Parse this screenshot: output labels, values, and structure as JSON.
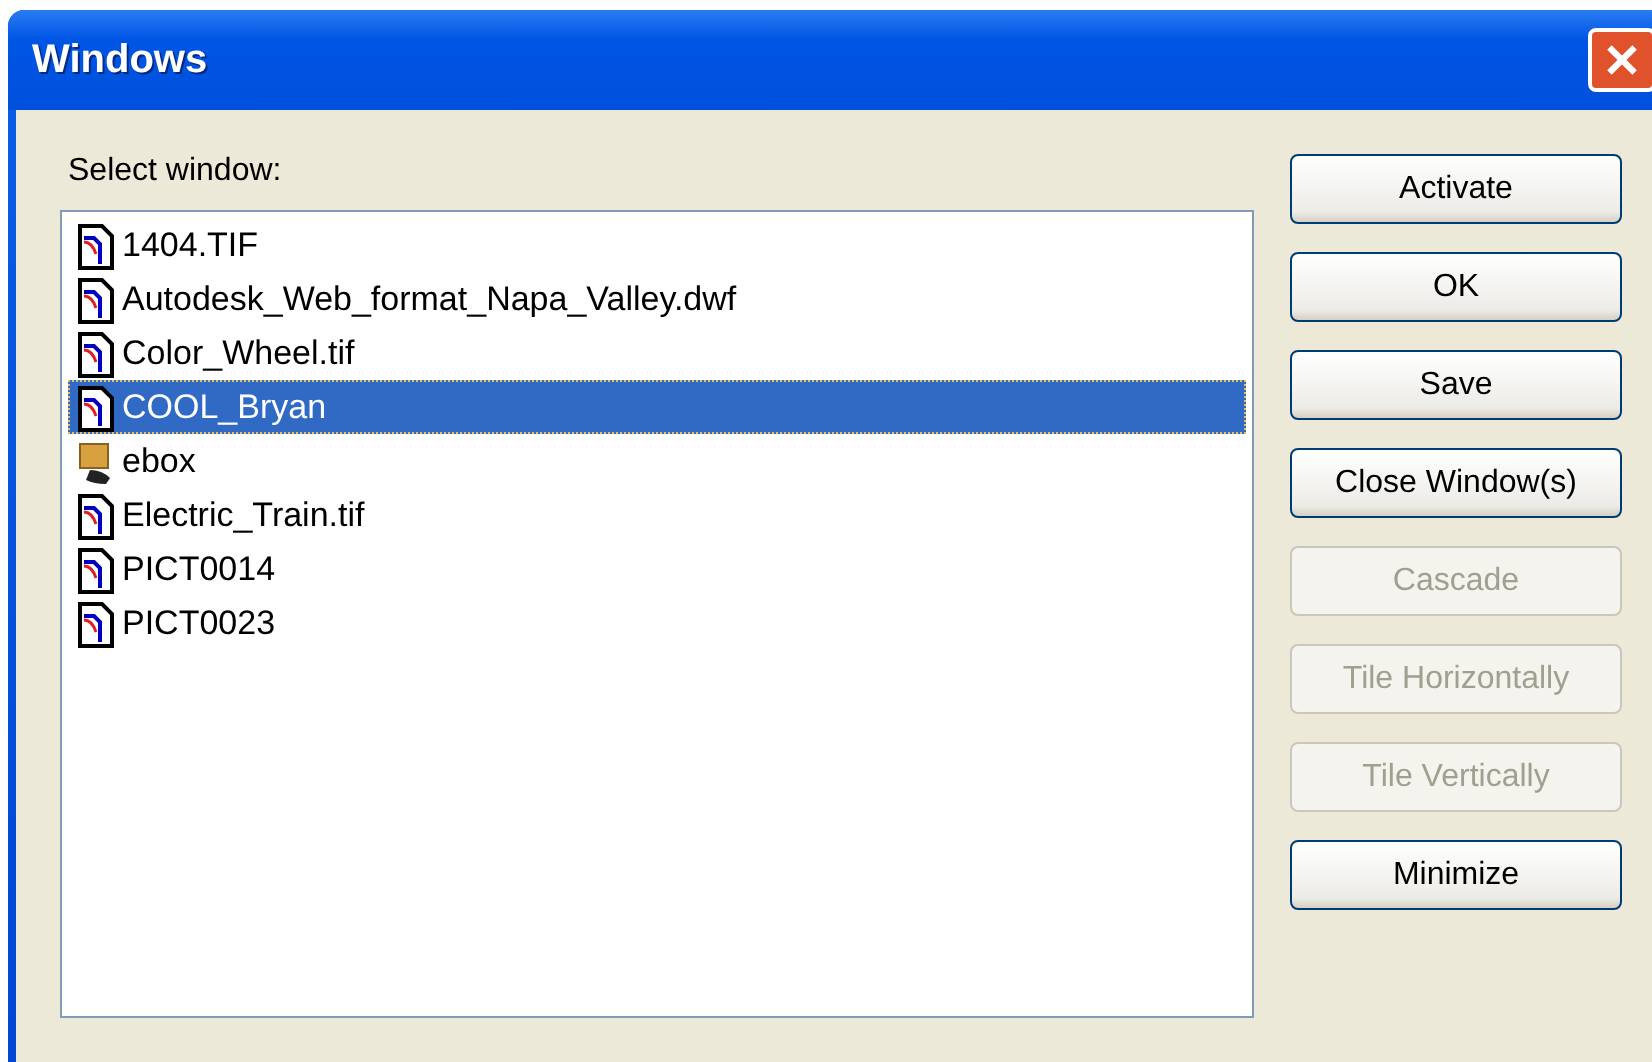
{
  "window": {
    "title": "Windows"
  },
  "list": {
    "label": "Select window:",
    "items": [
      {
        "name": "1404.TIF",
        "kind": "document",
        "selected": false
      },
      {
        "name": "Autodesk_Web_format_Napa_Valley.dwf",
        "kind": "document",
        "selected": false
      },
      {
        "name": "Color_Wheel.tif",
        "kind": "document",
        "selected": false
      },
      {
        "name": "COOL_Bryan",
        "kind": "document",
        "selected": true
      },
      {
        "name": "ebox",
        "kind": "box",
        "selected": false
      },
      {
        "name": "Electric_Train.tif",
        "kind": "document",
        "selected": false
      },
      {
        "name": "PICT0014",
        "kind": "document",
        "selected": false
      },
      {
        "name": "PICT0023",
        "kind": "document",
        "selected": false
      }
    ]
  },
  "buttons": [
    {
      "label": "Activate",
      "disabled": false
    },
    {
      "label": "OK",
      "disabled": false
    },
    {
      "label": "Save",
      "disabled": false
    },
    {
      "label": "Close Window(s)",
      "disabled": false
    },
    {
      "label": "Cascade",
      "disabled": true
    },
    {
      "label": "Tile Horizontally",
      "disabled": true
    },
    {
      "label": "Tile Vertically",
      "disabled": true
    },
    {
      "label": "Minimize",
      "disabled": false
    }
  ]
}
